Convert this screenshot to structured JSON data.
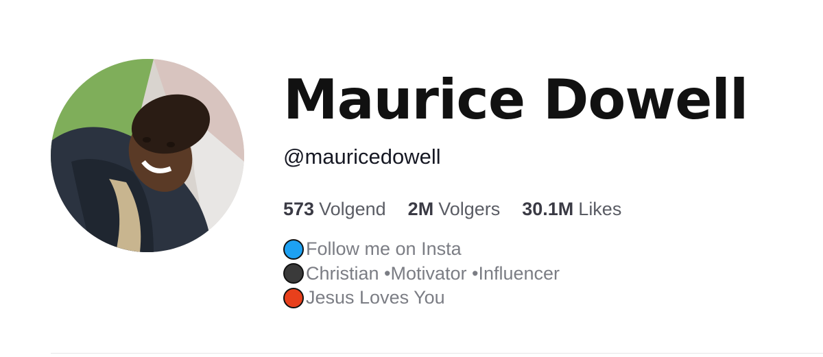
{
  "profile": {
    "name": "Maurice Dowell",
    "handle": "@mauricedowell"
  },
  "stats": [
    {
      "value": "573",
      "label": "Volgend"
    },
    {
      "value": "2M",
      "label": "Volgers"
    },
    {
      "value": "30.1M",
      "label": "Likes"
    }
  ],
  "bio": [
    {
      "icon": "blue-circle-icon",
      "color": "#1da1f2",
      "text": "Follow me on Insta"
    },
    {
      "icon": "black-circle-icon",
      "color": "#3a3a3a",
      "text": "Christian •Motivator •Influencer"
    },
    {
      "icon": "red-circle-icon",
      "color": "#e8401c",
      "text": "Jesus Loves You"
    }
  ]
}
